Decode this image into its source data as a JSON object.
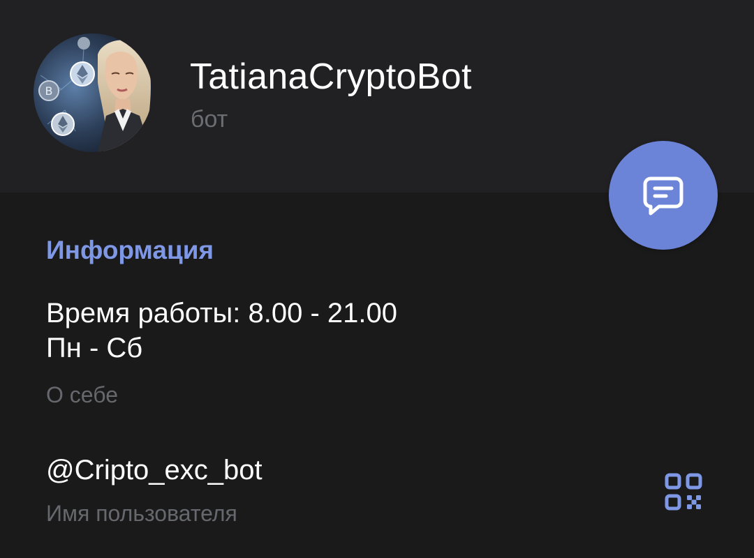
{
  "profile": {
    "name": "TatianaCryptoBot",
    "status": "бот",
    "avatar_icon": "profile-photo"
  },
  "info_section": {
    "title": "Информация",
    "about_lines": [
      "Время работы: 8.00 - 21.00",
      "Пн - Сб"
    ],
    "about_caption": "О себе",
    "username": "@Cripto_exc_bot",
    "username_caption": "Имя пользователя"
  },
  "actions": {
    "message_icon": "message-icon",
    "qr_icon": "qr-code-icon"
  },
  "colors": {
    "background": "#1a1a1b",
    "header_background": "#212123",
    "accent": "#7f98e6",
    "fab": "#6c84d7",
    "secondary_text": "#66686d"
  }
}
